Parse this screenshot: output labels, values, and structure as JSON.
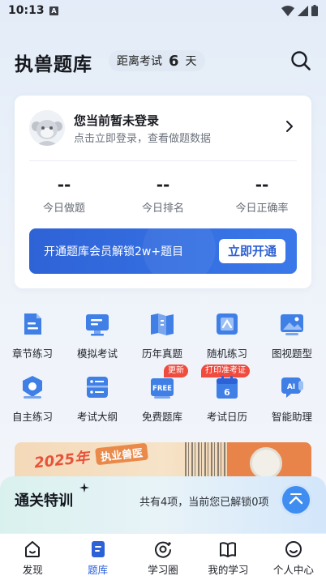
{
  "status_bar": {
    "time": "10:13",
    "sim_label": "A"
  },
  "header": {
    "title": "执兽题库",
    "countdown_prefix": "距离考试",
    "countdown_days": "6",
    "countdown_unit": "天"
  },
  "login": {
    "title": "您当前暂未登录",
    "subtitle": "点击立即登录，查看做题数据"
  },
  "stats": [
    {
      "value": "--",
      "label": "今日做题"
    },
    {
      "value": "--",
      "label": "今日排名"
    },
    {
      "value": "--",
      "label": "今日正确率"
    }
  ],
  "vip": {
    "text": "开通题库会员解锁2w+题目",
    "button": "立即开通"
  },
  "grid": [
    {
      "label": "章节练习",
      "icon": "chapter-practice-icon"
    },
    {
      "label": "模拟考试",
      "icon": "mock-exam-icon"
    },
    {
      "label": "历年真题",
      "icon": "past-papers-icon"
    },
    {
      "label": "随机练习",
      "icon": "random-practice-icon"
    },
    {
      "label": "图视题型",
      "icon": "image-questions-icon"
    },
    {
      "label": "自主练习",
      "icon": "self-practice-icon"
    },
    {
      "label": "考试大纲",
      "icon": "exam-syllabus-icon"
    },
    {
      "label": "免费题库",
      "icon": "free-bank-icon",
      "badge": "更新",
      "icon_text": "FREE"
    },
    {
      "label": "考试日历",
      "icon": "exam-calendar-icon",
      "badge": "打印准考证",
      "icon_text": "6"
    },
    {
      "label": "智能助理",
      "icon": "ai-assistant-icon",
      "icon_text": "AI"
    }
  ],
  "banner": {
    "year_text": "2025年",
    "tag_text": "执业兽医"
  },
  "training": {
    "title": "通关特训",
    "info": "共有4项，当前您已解锁0项"
  },
  "nav": [
    {
      "label": "发现",
      "icon": "discover-icon"
    },
    {
      "label": "题库",
      "icon": "question-bank-icon",
      "active": true
    },
    {
      "label": "学习圈",
      "icon": "study-circle-icon"
    },
    {
      "label": "我的学习",
      "icon": "my-study-icon"
    },
    {
      "label": "个人中心",
      "icon": "profile-icon"
    }
  ],
  "colors": {
    "accent": "#2c61d8",
    "badge": "#ef4b3f",
    "icon_blue": "#3f7fe6"
  }
}
